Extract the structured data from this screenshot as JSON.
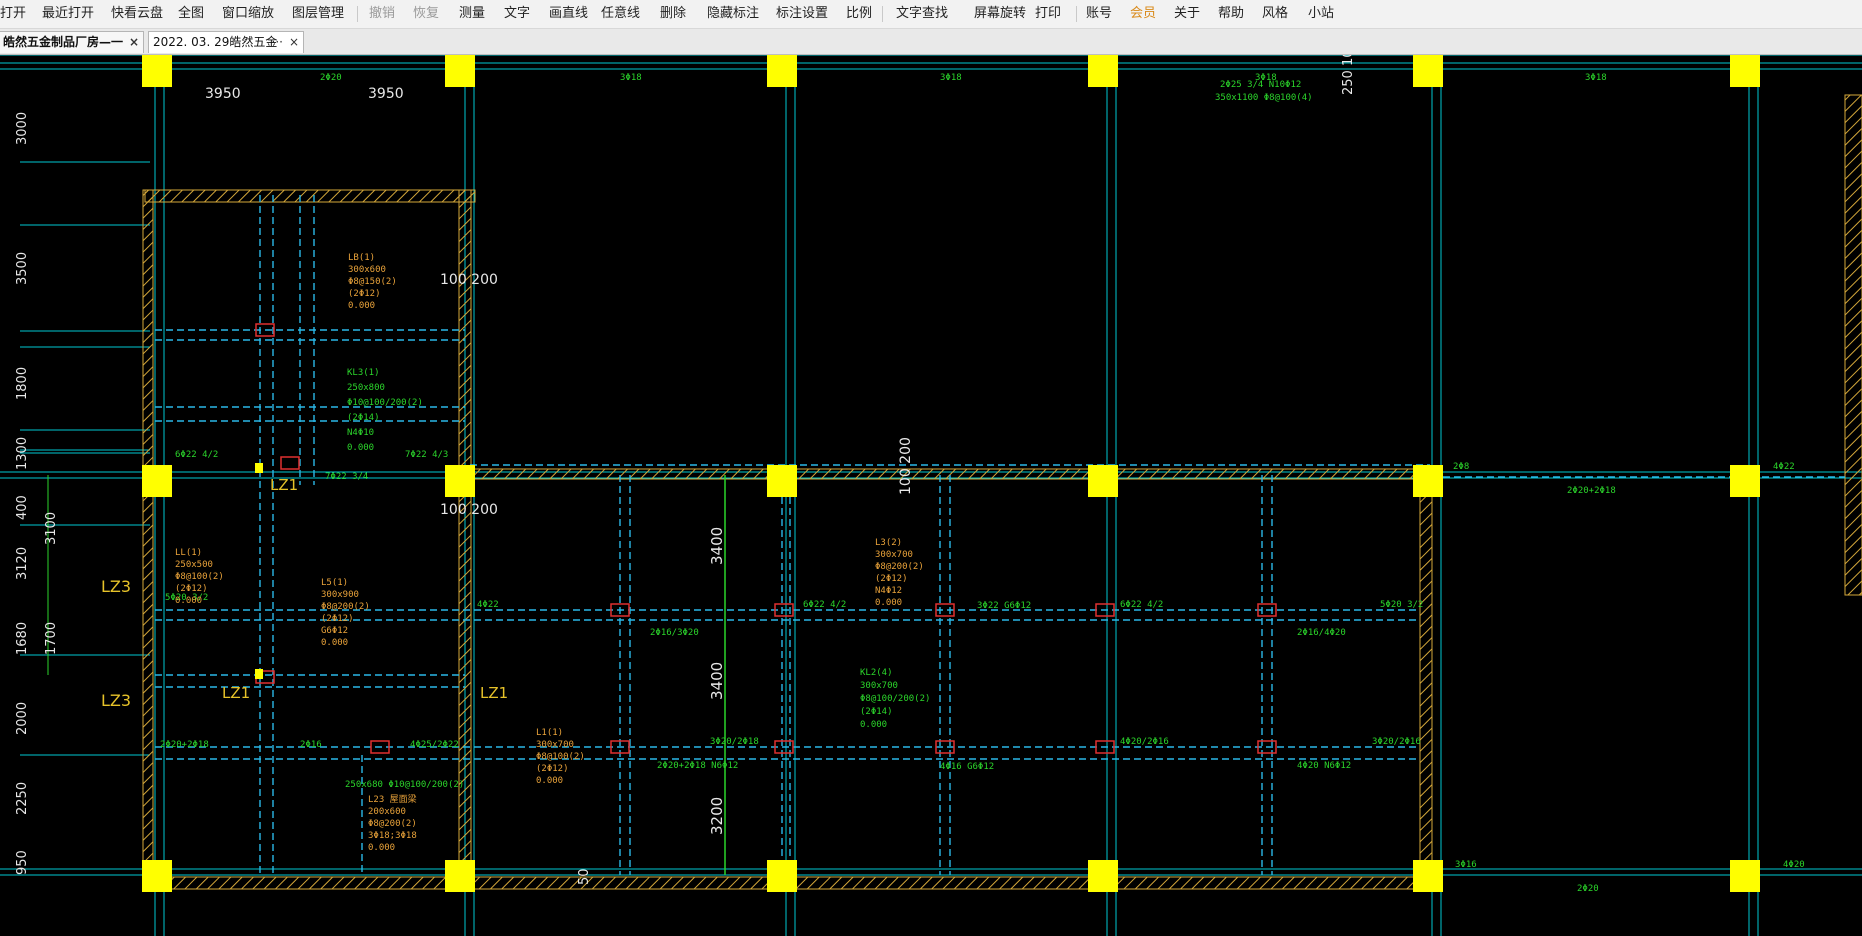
{
  "toolbar": {
    "items": [
      {
        "label": "打开",
        "disabled": false
      },
      {
        "label": "最近打开",
        "disabled": false
      },
      {
        "label": "快看云盘",
        "disabled": false
      },
      {
        "label": "全图",
        "disabled": false
      },
      {
        "label": "窗口缩放",
        "disabled": false
      },
      {
        "label": "图层管理",
        "disabled": false
      },
      {
        "label": "撤销",
        "disabled": true
      },
      {
        "label": "恢复",
        "disabled": true
      },
      {
        "label": "测量",
        "disabled": false
      },
      {
        "label": "文字",
        "disabled": false
      },
      {
        "label": "画直线",
        "disabled": false
      },
      {
        "label": "任意线",
        "disabled": false
      },
      {
        "label": "删除",
        "disabled": false
      },
      {
        "label": "隐藏标注",
        "disabled": false
      },
      {
        "label": "标注设置",
        "disabled": false
      },
      {
        "label": "比例",
        "disabled": false
      },
      {
        "label": "文字查找",
        "disabled": false
      },
      {
        "label": "屏幕旋转",
        "disabled": false
      },
      {
        "label": "打印",
        "disabled": false
      },
      {
        "label": "账号",
        "disabled": false
      },
      {
        "label": "会员",
        "disabled": false
      },
      {
        "label": "关于",
        "disabled": false
      },
      {
        "label": "帮助",
        "disabled": false
      },
      {
        "label": "风格",
        "disabled": false
      },
      {
        "label": "小站",
        "disabled": false
      }
    ]
  },
  "tabs": [
    {
      "label": "皓然五金制品厂房—一",
      "active": true,
      "close": "×"
    },
    {
      "label": "2022. 03. 29皓然五金",
      "active": false,
      "more": "···",
      "close": "×"
    }
  ],
  "drawing": {
    "dims_top": [
      "3950",
      "3950"
    ],
    "dims_left": [
      "3000",
      "3500",
      "1800",
      "1300",
      "400",
      "3120",
      "1680",
      "2000",
      "2250",
      "950"
    ],
    "dims_left2": [
      "3100",
      "1700"
    ],
    "dims_vertical": [
      "3400",
      "3400",
      "3200"
    ],
    "markers": [
      "100 200",
      "100 200",
      "100 200"
    ],
    "column_tags": [
      "LZ1",
      "LZ1",
      "LZ1",
      "LZ1"
    ],
    "side_tags": [
      "LZ3",
      "LZ3"
    ],
    "top_right_label": "250 10",
    "bottom_label": "50",
    "green_labels": [
      "2Φ20",
      "3Φ18",
      "3Φ18",
      "3Φ18",
      "3Φ18",
      "2Φ25 3/4 N10Φ12",
      "350x1100 Φ8@100(4)",
      "6Φ22 4/2",
      "7Φ22 4/3",
      "7Φ22 3/4",
      "2Φ8",
      "4Φ22",
      "2Φ20+2Φ18",
      "4Φ22",
      "6Φ22 4/2",
      "3Φ22 G6Φ12",
      "6Φ22 4/2",
      "5Φ20 3/2",
      "3Φ20/2Φ18",
      "2Φ20+2Φ18 N6Φ12",
      "4Φ20/2Φ16",
      "4Φ16 G6Φ12",
      "4Φ20 N6Φ12",
      "3Φ20/2Φ16",
      "3Φ16",
      "4Φ20",
      "2Φ20",
      "5Φ20 3/2",
      "2Φ16/3Φ20",
      "2Φ16/4Φ20",
      "2Φ20+2Φ18",
      "2Φ16",
      "4Φ25/2Φ22",
      "250x680 Φ10@100/200(2)",
      "KL3(1)",
      "250x800",
      "Φ10@100/200(2)",
      "(2Φ14)",
      "N4Φ10",
      "0.000",
      "KL2(4)",
      "300x700",
      "Φ8@100/200(2)",
      "(2Φ14)",
      "0.000"
    ],
    "orange_labels": [
      "LB(1)",
      "300x600",
      "Φ8@150(2)",
      "(2Φ12)",
      "0.000",
      "LL(1)",
      "250x500",
      "Φ8@100(2)",
      "(2Φ12)",
      "0.000",
      "L3(2)",
      "300x700",
      "Φ8@200(2)",
      "(2Φ12)",
      "N4Φ12",
      "0.000",
      "L5(1)",
      "300x900",
      "Φ8@200(2)",
      "(2Φ12)",
      "G6Φ12",
      "0.000",
      "L23 屋面梁",
      "200x600",
      "Φ8@200(2)",
      "3Φ18;3Φ18",
      "0.000",
      "L1(1)",
      "300x700",
      "Φ8@100(2)",
      "(2Φ12)",
      "0.000"
    ]
  },
  "colors": {
    "background": "#000000",
    "axis": "#00c8d2",
    "dashed_beam": "#2bb8e8",
    "column": "#ffff00",
    "hatch_wall": "#d4a73a",
    "rebar_red": "#e03030",
    "text_green": "#2bd52b",
    "text_orange": "#e8a23a",
    "text_white": "#e8e8e8"
  }
}
